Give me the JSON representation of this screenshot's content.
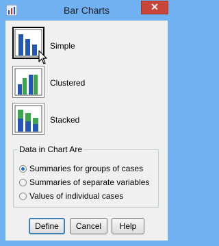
{
  "window": {
    "title": "Bar Charts",
    "close_symbol": "✕",
    "icon": "spss-app-icon",
    "frame_color": "#6fb1f1",
    "close_color": "#c9453a"
  },
  "chart_types": [
    {
      "label": "Simple",
      "icon": "simple-bar-chart-icon",
      "selected": true
    },
    {
      "label": "Clustered",
      "icon": "clustered-bar-chart-icon",
      "selected": false
    },
    {
      "label": "Stacked",
      "icon": "stacked-bar-chart-icon",
      "selected": false
    }
  ],
  "data_group": {
    "title": "Data in Chart Are",
    "options": [
      {
        "label": "Summaries for groups of cases",
        "selected": true
      },
      {
        "label": "Summaries of separate variables",
        "selected": false
      },
      {
        "label": "Values of individual cases",
        "selected": false
      }
    ]
  },
  "buttons": {
    "define": "Define",
    "cancel": "Cancel",
    "help": "Help"
  },
  "colors": {
    "blue_bar": "#2456b8",
    "green_bar": "#3aa84a"
  }
}
